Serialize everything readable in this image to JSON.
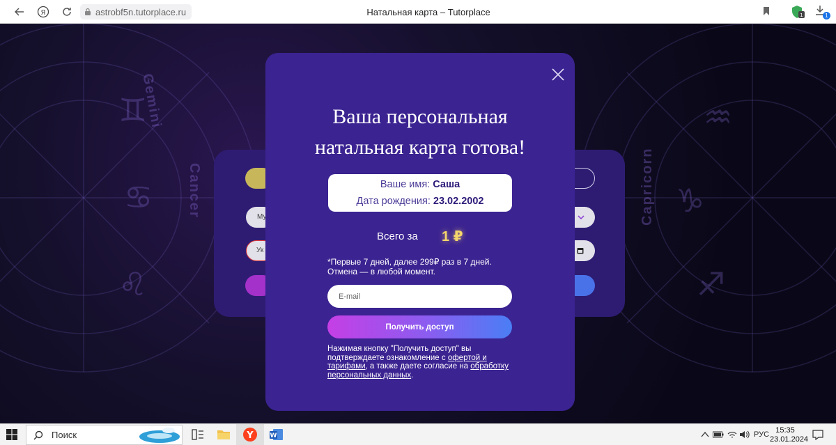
{
  "browser": {
    "url": "astrobf5n.tutorplace.ru",
    "tab_title": "Натальная карта – Tutorplace",
    "download_count": "1"
  },
  "background": {
    "zodiac_labels": [
      "Gemini",
      "Cancer",
      "Capricorn"
    ]
  },
  "form_behind": {
    "select_partial": "Му",
    "input_partial": "Ук"
  },
  "modal": {
    "title_line1": "Ваша персональная",
    "title_line2": "натальная карта готова!",
    "name_label": "Ваше имя:",
    "name_value": "Саша",
    "birth_label": "Дата рождения:",
    "birth_value": "23.02.2002",
    "total_label": "Всего за",
    "price": "1 ₽",
    "note_line1": "*Первые 7 дней, далее 299₽ раз в 7 дней.",
    "note_line2": "Отмена — в любой момент.",
    "email_placeholder": "E-mail",
    "cta_label": "Получить доступ",
    "legal": {
      "part1": "Нажимая кнопку \"Получить доступ\" вы подтверждаете ознакомление с ",
      "link_offer": "офертой и тарифами",
      "part2": ", а также даете согласие на ",
      "link_privacy": "обработку персональных данных",
      "part3": "."
    }
  },
  "taskbar": {
    "search_label": "Поиск",
    "language": "РУС",
    "time": "15:35",
    "date": "23.01.2024"
  }
}
